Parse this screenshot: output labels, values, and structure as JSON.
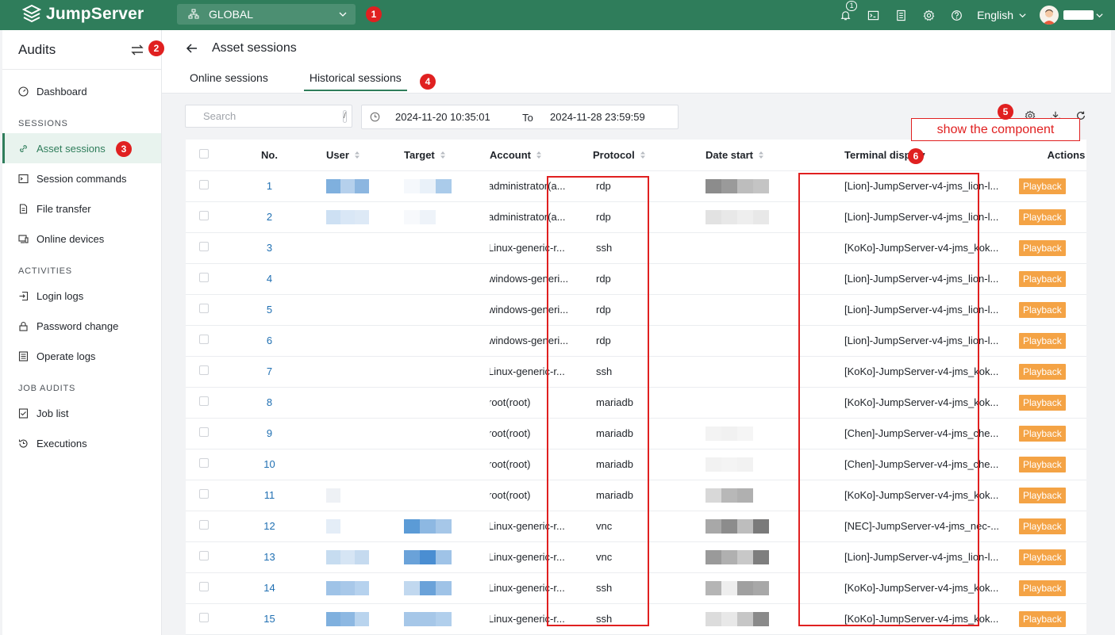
{
  "topbar": {
    "brand": "JumpServer",
    "org_label": "GLOBAL",
    "notification_count": "1",
    "language": "English",
    "accent": "#2f7d5b"
  },
  "markers": [
    "1",
    "2",
    "3",
    "4",
    "5",
    "6"
  ],
  "sidebar": {
    "title": "Audits",
    "items": [
      {
        "label": "Dashboard",
        "icon": "dashboard-icon"
      },
      {
        "section": "SESSIONS"
      },
      {
        "label": "Asset sessions",
        "icon": "link-icon",
        "active": true
      },
      {
        "label": "Session commands",
        "icon": "terminal-icon"
      },
      {
        "label": "File transfer",
        "icon": "file-icon"
      },
      {
        "label": "Online devices",
        "icon": "device-icon"
      },
      {
        "section": "ACTIVITIES"
      },
      {
        "label": "Login logs",
        "icon": "login-icon"
      },
      {
        "label": "Password change",
        "icon": "lock-icon"
      },
      {
        "label": "Operate logs",
        "icon": "list-icon"
      },
      {
        "section": "JOB AUDITS"
      },
      {
        "label": "Job list",
        "icon": "checklist-icon"
      },
      {
        "label": "Executions",
        "icon": "history-icon"
      }
    ]
  },
  "page": {
    "title": "Asset sessions",
    "tabs": [
      "Online sessions",
      "Historical sessions"
    ],
    "active_tab": 1
  },
  "filters": {
    "search_placeholder": "Search",
    "search_shortcut": "/",
    "date_start": "2024-11-20 10:35:01",
    "date_to": "To",
    "date_end": "2024-11-28 23:59:59"
  },
  "tooltip": "show the component",
  "table": {
    "columns": [
      "No.",
      "User",
      "Target",
      "Account",
      "Protocol",
      "Date start",
      "Terminal display",
      "Actions"
    ],
    "actions": {
      "playback": "Playback",
      "download": "Download"
    },
    "rows": [
      {
        "no": "1",
        "account": "administrator(a...",
        "protocol": "rdp",
        "terminal": "[Lion]-JumpServer-v4-jms_lion-l..."
      },
      {
        "no": "2",
        "account": "administrator(a...",
        "protocol": "rdp",
        "terminal": "[Lion]-JumpServer-v4-jms_lion-l..."
      },
      {
        "no": "3",
        "account": "Linux-generic-r...",
        "protocol": "ssh",
        "terminal": "[KoKo]-JumpServer-v4-jms_kok..."
      },
      {
        "no": "4",
        "account": "windows-generi...",
        "protocol": "rdp",
        "terminal": "[Lion]-JumpServer-v4-jms_lion-l..."
      },
      {
        "no": "5",
        "account": "windows-generi...",
        "protocol": "rdp",
        "terminal": "[Lion]-JumpServer-v4-jms_lion-l..."
      },
      {
        "no": "6",
        "account": "windows-generi...",
        "protocol": "rdp",
        "terminal": "[Lion]-JumpServer-v4-jms_lion-l..."
      },
      {
        "no": "7",
        "account": "Linux-generic-r...",
        "protocol": "ssh",
        "terminal": "[KoKo]-JumpServer-v4-jms_kok..."
      },
      {
        "no": "8",
        "account": "root(root)",
        "protocol": "mariadb",
        "terminal": "[KoKo]-JumpServer-v4-jms_kok..."
      },
      {
        "no": "9",
        "account": "root(root)",
        "protocol": "mariadb",
        "terminal": "[Chen]-JumpServer-v4-jms_che..."
      },
      {
        "no": "10",
        "account": "root(root)",
        "protocol": "mariadb",
        "terminal": "[Chen]-JumpServer-v4-jms_che..."
      },
      {
        "no": "11",
        "account": "root(root)",
        "protocol": "mariadb",
        "terminal": "[KoKo]-JumpServer-v4-jms_kok..."
      },
      {
        "no": "12",
        "account": "Linux-generic-r...",
        "protocol": "vnc",
        "terminal": "[NEC]-JumpServer-v4-jms_nec-..."
      },
      {
        "no": "13",
        "account": "Linux-generic-r...",
        "protocol": "vnc",
        "terminal": "[Lion]-JumpServer-v4-jms_lion-l..."
      },
      {
        "no": "14",
        "account": "Linux-generic-r...",
        "protocol": "ssh",
        "terminal": "[KoKo]-JumpServer-v4-jms_kok..."
      },
      {
        "no": "15",
        "account": "Linux-generic-r...",
        "protocol": "ssh",
        "terminal": "[KoKo]-JumpServer-v4-jms_kok..."
      }
    ]
  }
}
